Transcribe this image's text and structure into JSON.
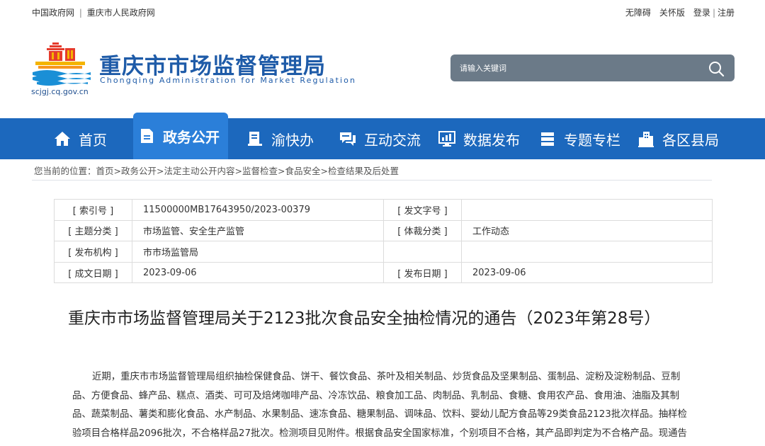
{
  "topbar": {
    "left_link_1": "中国政府网",
    "separator": "|",
    "left_link_2": "重庆市人民政府网",
    "accessibility": "无障碍",
    "care_mode": "关怀版",
    "login": "登录",
    "register": "注册"
  },
  "header": {
    "site_title": "重庆市市场监督管理局",
    "site_subtitle": "Chongqing Administration for Market Regulation",
    "domain": "scjgj.cq.gov.cn"
  },
  "search": {
    "placeholder": "请输入关键词"
  },
  "nav": {
    "items": [
      {
        "label": "首页",
        "icon": "home-icon"
      },
      {
        "label": "政务公开",
        "icon": "document-icon"
      },
      {
        "label": "渝快办",
        "icon": "book-icon"
      },
      {
        "label": "互动交流",
        "icon": "chat-icon"
      },
      {
        "label": "数据发布",
        "icon": "chart-icon"
      },
      {
        "label": "专题专栏",
        "icon": "list-icon"
      },
      {
        "label": "各区县局",
        "icon": "buildings-icon"
      }
    ],
    "active_index": 1,
    "color": "#1c68bd"
  },
  "breadcrumb": {
    "prefix": "您当前的位置：",
    "items": [
      "首页",
      "政务公开",
      "法定主动公开内容",
      "监督检查",
      "食品安全",
      "检查结果及后处置"
    ],
    "separator": ">"
  },
  "meta": {
    "index_no_label": "[ 索引号 ]",
    "index_no": "11500000MB17643950/2023-00379",
    "doc_no_label": "[ 发文字号 ]",
    "doc_no": "",
    "topic_label": "[ 主题分类 ]",
    "topic": "市场监管、安全生产监管",
    "genre_label": "[ 体裁分类 ]",
    "genre": "工作动态",
    "publisher_label": "[ 发布机构 ]",
    "publisher": "市市场监管局",
    "created_label": "[ 成文日期 ]",
    "created": "2023-09-06",
    "published_label": "[ 发布日期 ]",
    "published": "2023-09-06"
  },
  "article": {
    "title": "重庆市市场监督管理局关于2123批次食品安全抽检情况的通告（2023年第28号）",
    "paragraph_1": "近期，重庆市市场监督管理局组织抽检保健食品、饼干、餐饮食品、茶叶及相关制品、炒货食品及坚果制品、蛋制品、淀粉及淀粉制品、豆制品、方便食品、蜂产品、糕点、酒类、可可及焙烤咖啡产品、冷冻饮品、粮食加工品、肉制品、乳制品、食糖、食用农产品、食用油、油脂及其制品、蔬菜制品、薯类和膨化食品、水产制品、水果制品、速冻食品、糖果制品、调味品、饮料、婴幼儿配方食品等29类食品2123批次样品。抽样检验项目合格样品2096批次，不合格样品27批次。检测项目见附件。根据食品安全国家标准，个别项目不合格，其产品即判定为不合格产品。现通告如下："
  }
}
